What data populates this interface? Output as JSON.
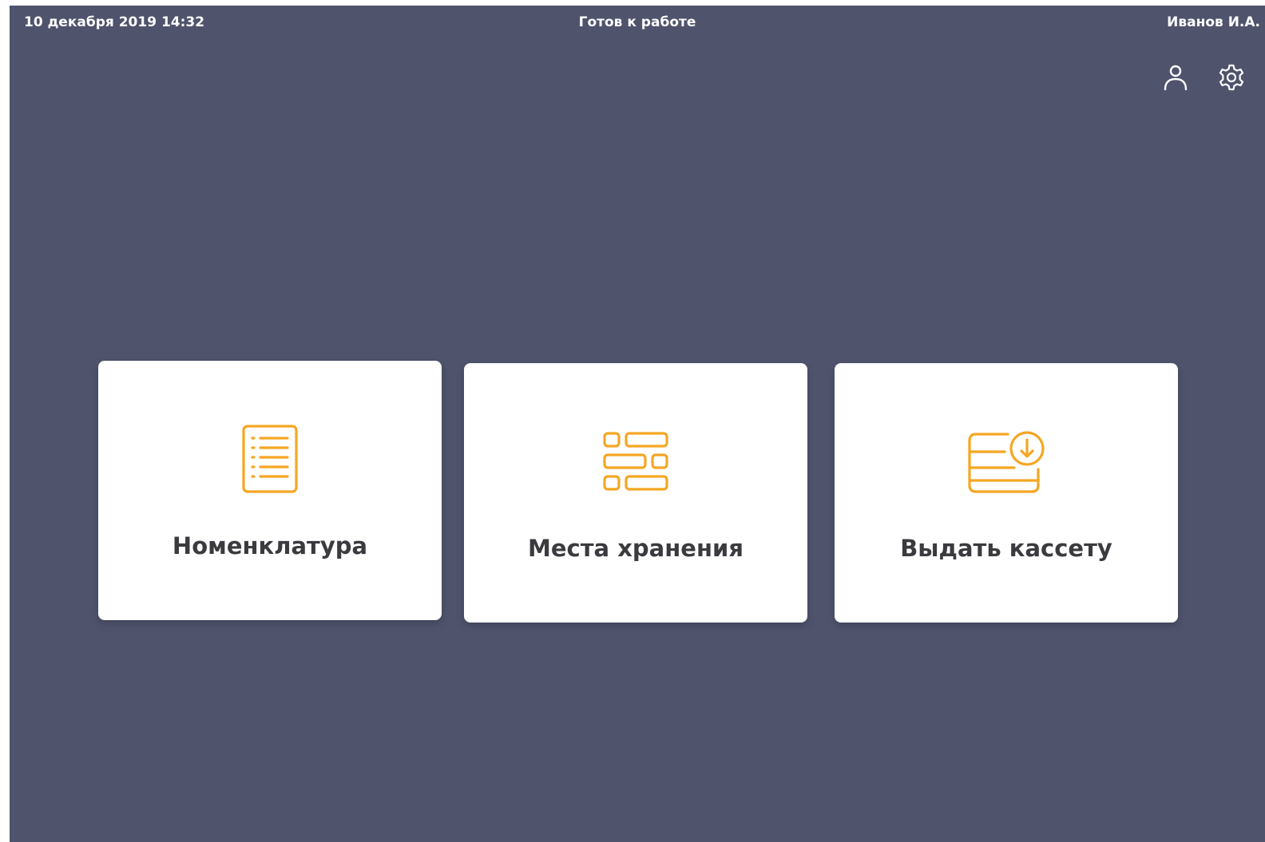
{
  "status_bar": {
    "datetime": "10 декабря 2019 14:32",
    "status": "Готов к работе",
    "user": "Иванов И.А."
  },
  "toolbar": {
    "icons": [
      "user-icon",
      "gear-icon"
    ]
  },
  "tiles": [
    {
      "label": "Номенклатура",
      "icon": "list-document-icon"
    },
    {
      "label": "Места хранения",
      "icon": "storage-blocks-icon"
    },
    {
      "label": "Выдать кассету",
      "icon": "cassette-download-icon"
    }
  ],
  "colors": {
    "background": "#4f536c",
    "tile": "#ffffff",
    "accent": "#f5a623",
    "text": "#3a3a3f",
    "status_text": "#ffffff"
  }
}
